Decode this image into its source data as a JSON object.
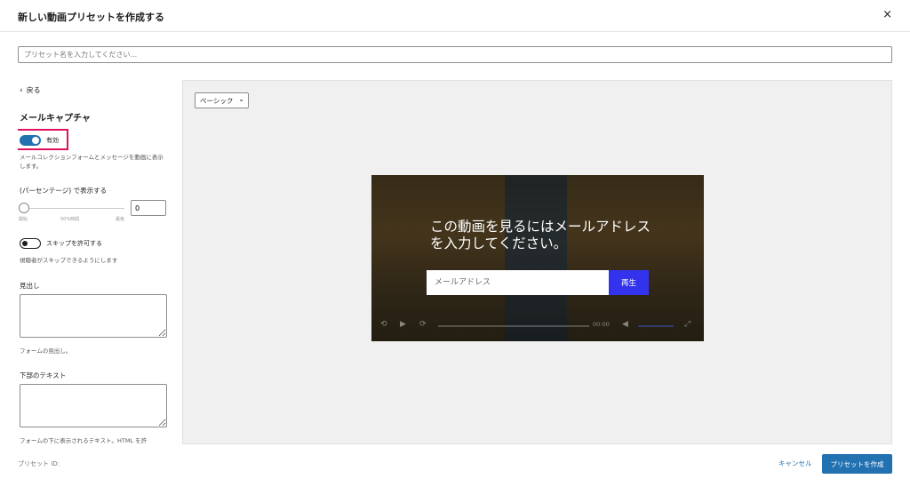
{
  "header": {
    "title": "新しい動画プリセットを作成する",
    "close_glyph": "×"
  },
  "preset_name": {
    "placeholder": "プリセット名を入力してください..."
  },
  "sidebar": {
    "back_label": "戻る",
    "section_title": "メールキャプチャ",
    "enabled": {
      "label": "有効",
      "state": true
    },
    "enabled_help": "メールコレクションフォームとメッセージを動画に表示します。",
    "percentage_label": "(パーセンテージ) で表示する",
    "slider": {
      "start": "開始",
      "middle": "50%時間",
      "end": "最後",
      "value": "0"
    },
    "skip": {
      "label": "スキップを許可する",
      "state": false
    },
    "skip_help": "視聴者がスキップできるようにします",
    "headline_label": "見出し",
    "headline_help": "フォームの見出し。",
    "bottom_text_label": "下部のテキスト",
    "bottom_text_help": "フォームの下に表示されるテキスト。HTML を許"
  },
  "preview": {
    "style_select": "ベーシック",
    "heading": "この動画を見るにはメールアドレスを入力してください。",
    "email_placeholder": "メールアドレス",
    "play_button": "再生",
    "time": "00:00"
  },
  "footer": {
    "preset_id_label": "プリセット ID:",
    "cancel_label": "キャンセル",
    "create_label": "プリセットを作成"
  },
  "colors": {
    "accent": "#2271b1",
    "highlight": "#e0115f",
    "play_button": "#3333ee"
  }
}
